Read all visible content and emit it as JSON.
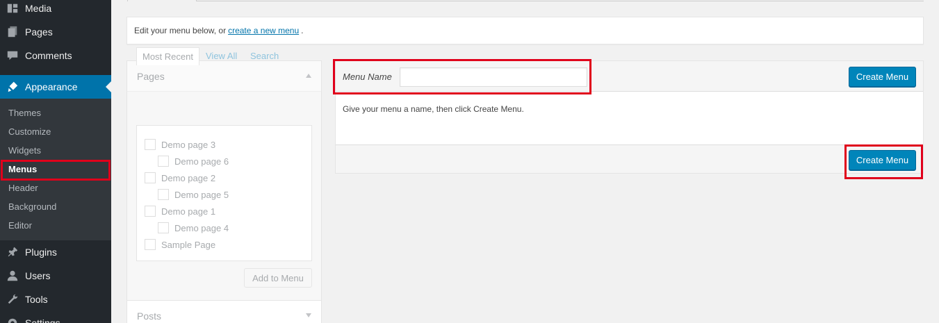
{
  "sidebar": {
    "top_items": [
      {
        "label": "Media",
        "icon": "media-icon"
      },
      {
        "label": "Pages",
        "icon": "pages-icon"
      },
      {
        "label": "Comments",
        "icon": "comments-icon"
      },
      {
        "label": "Appearance",
        "icon": "appearance-icon"
      },
      {
        "label": "Plugins",
        "icon": "plugins-icon"
      },
      {
        "label": "Users",
        "icon": "users-icon"
      },
      {
        "label": "Tools",
        "icon": "tools-icon"
      },
      {
        "label": "Settings",
        "icon": "settings-icon"
      }
    ],
    "submenu": [
      "Themes",
      "Customize",
      "Widgets",
      "Menus",
      "Header",
      "Background",
      "Editor"
    ]
  },
  "notice": {
    "text_before": "Edit your menu below, or",
    "link": "create a new menu",
    "text_after": "."
  },
  "pages_box": {
    "title": "Pages",
    "tabs": [
      "Most Recent",
      "View All",
      "Search"
    ],
    "items": [
      {
        "label": "Demo page 3",
        "level": 0
      },
      {
        "label": "Demo page 6",
        "level": 1
      },
      {
        "label": "Demo page 2",
        "level": 0
      },
      {
        "label": "Demo page 5",
        "level": 1
      },
      {
        "label": "Demo page 1",
        "level": 0
      },
      {
        "label": "Demo page 4",
        "level": 1
      },
      {
        "label": "Sample Page",
        "level": 0
      }
    ],
    "add_button": "Add to Menu"
  },
  "posts_box": {
    "title": "Posts"
  },
  "editor": {
    "menu_name_label": "Menu Name",
    "menu_name_value": "",
    "create_label": "Create Menu",
    "instruction": "Give your menu a name, then click Create Menu."
  },
  "colors": {
    "sidebar_bg": "#23282d",
    "submenu_bg": "#32373c",
    "accent": "#0073aa",
    "button_primary": "#0085ba",
    "highlight": "#e0001b"
  }
}
